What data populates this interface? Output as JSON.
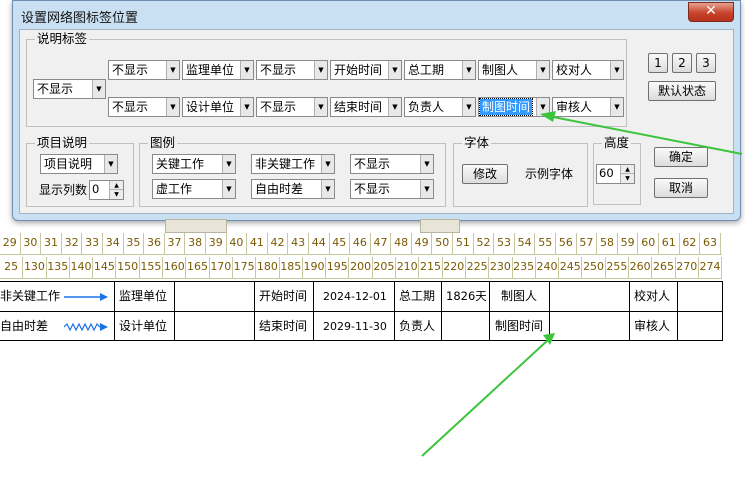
{
  "dialog": {
    "title": "设置网络图标签位置",
    "close_icon": "close-icon",
    "annotation_group": {
      "label": "说明标签",
      "left_dropdown": "不显示",
      "row1": [
        "不显示",
        "监理单位",
        "不显示",
        "开始时间",
        "总工期",
        "制图人",
        "校对人"
      ],
      "row2": [
        "不显示",
        "设计单位",
        "不显示",
        "结束时间",
        "负责人",
        "制图时间",
        "审核人"
      ],
      "page_buttons": [
        "1",
        "2",
        "3"
      ],
      "default_button": "默认状态"
    },
    "project_group": {
      "label": "项目说明",
      "dropdown": "项目说明",
      "columns_label": "显示列数",
      "columns_value": "0"
    },
    "legend_group": {
      "label": "图例",
      "row1": [
        "关键工作",
        "非关键工作",
        "不显示"
      ],
      "row2": [
        "虚工作",
        "自由时差",
        "不显示"
      ]
    },
    "font_group": {
      "label": "字体",
      "modify_button": "修改",
      "sample_text": "示例字体"
    },
    "height_group": {
      "label": "高度",
      "value": "60"
    },
    "ok_button": "确定",
    "cancel_button": "取消"
  },
  "background": {
    "ruler_top": [
      "29",
      "30",
      "31",
      "32",
      "33",
      "34",
      "35",
      "36",
      "37",
      "38",
      "39",
      "40",
      "41",
      "42",
      "43",
      "44",
      "45",
      "46",
      "47",
      "48",
      "49",
      "50",
      "51",
      "52",
      "53",
      "54",
      "55",
      "56",
      "57",
      "58",
      "59",
      "60",
      "61",
      "62",
      "63"
    ],
    "ruler_bottom": [
      "25",
      "130",
      "135",
      "140",
      "145",
      "150",
      "155",
      "160",
      "165",
      "170",
      "175",
      "180",
      "185",
      "190",
      "195",
      "200",
      "205",
      "210",
      "215",
      "220",
      "225",
      "230",
      "235",
      "240",
      "245",
      "250",
      "255",
      "260",
      "265",
      "270",
      "274"
    ],
    "legend_rows": [
      {
        "legend": "非关键工作",
        "legend_icon": "arrow-icon",
        "org": "监理单位",
        "time_label": "开始时间",
        "time_value": "2024-12-01",
        "dur_label": "总工期",
        "dur_value": "1826天",
        "draw_label": "制图人",
        "check_label": "校对人"
      },
      {
        "legend": "自由时差",
        "legend_icon": "wavy-arrow-icon",
        "org": "设计单位",
        "time_label": "结束时间",
        "time_value": "2029-11-30",
        "dur_label": "负责人",
        "dur_value": "",
        "draw_label": "制图时间",
        "check_label": "审核人"
      }
    ]
  },
  "colors": {
    "annotation_arrow": "#3cc43c",
    "legend_arrow": "#1a73e8",
    "selection": "#3399ff"
  }
}
